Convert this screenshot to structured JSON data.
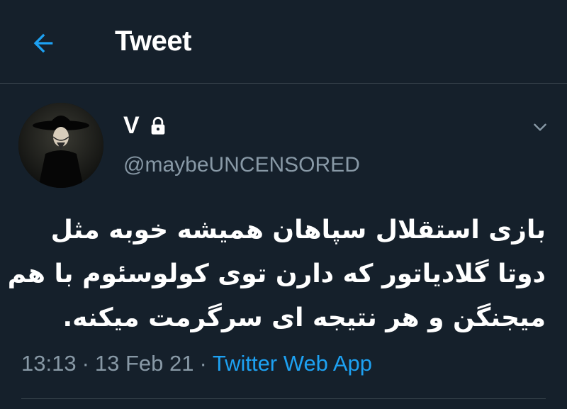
{
  "header": {
    "title": "Tweet",
    "back_icon": "arrow-left-icon"
  },
  "colors": {
    "background": "#15202b",
    "accent": "#1da1f2",
    "secondary_text": "#8899a6",
    "divider": "#38444d"
  },
  "tweet": {
    "author": {
      "display_name": "V",
      "handle": "@maybeUNCENSORED",
      "protected_icon": "lock-icon",
      "avatar_icon": "avatar-image"
    },
    "menu_icon": "chevron-down-icon",
    "text_lines": [
      "بازی استقلال سپاهان همیشه خوبه مثل",
      "دوتا گلادیاتور که دارن توی کولوسئوم با هم",
      "میجنگن و هر نتیجه ای سرگرمت میکنه."
    ],
    "time": "13:13",
    "date": "13 Feb 21",
    "separator": "·",
    "source": "Twitter Web App"
  }
}
